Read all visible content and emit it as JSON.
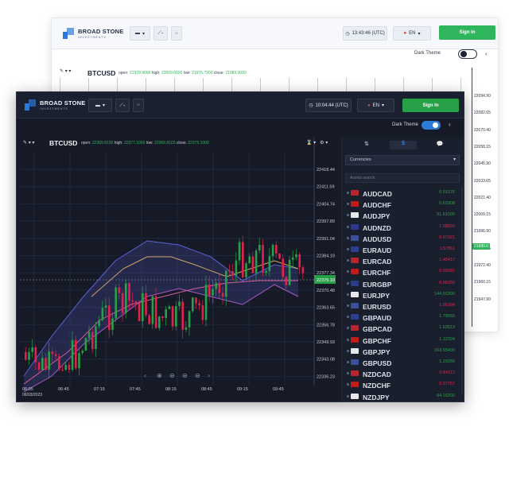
{
  "back_window": {
    "logo_title": "BROAD STONE",
    "logo_subtitle": "INVESTMENTS",
    "time_label": "13:43:46 (UTC)",
    "lang_label": "EN",
    "signin_label": "Sign In",
    "dark_theme_label": "Dark Theme",
    "symbol": "BTCUSD",
    "ohlc": {
      "open_label": "open:",
      "open": "21979.9000",
      "high_label": "high:",
      "high": "22009.8100",
      "low_label": "low:",
      "low": "21976.7900",
      "close_label": "close:",
      "close": "21989.0000"
    },
    "prices": [
      "22094.90",
      "22082.65",
      "22070.40",
      "22058.15",
      "22045.90",
      "22033.65",
      "22021.40",
      "22009.15",
      "21996.90",
      "21984.65",
      "21972.40",
      "21960.15",
      "21947.90"
    ],
    "price_tag": "21989.0"
  },
  "front_window": {
    "logo_title": "BROAD STONE",
    "logo_subtitle": "INVESTMENTS",
    "time_label": "10:04:44 (UTC)",
    "lang_label": "EN",
    "signin_label": "Sign In",
    "dark_theme_label": "Dark Theme",
    "symbol": "BTCUSD",
    "ohlc": {
      "open_label": "open:",
      "open": "22369.8100",
      "high_label": "high:",
      "high": "22377.1000",
      "low_label": "low:",
      "low": "22369.8100",
      "close_label": "close:",
      "close": "22375.1000"
    },
    "panel": {
      "select_label": "Currencies",
      "search_placeholder": "Assets search",
      "instruments": [
        {
          "symbol": "AUDCAD",
          "value": "0.91576",
          "up": true,
          "flag": "#b7252e"
        },
        {
          "symbol": "AUDCHF",
          "value": "0.62908",
          "up": true,
          "flag": "#c21b1b"
        },
        {
          "symbol": "AUDJPY",
          "value": "91.61000",
          "up": true,
          "flag": "#e8e8e8"
        },
        {
          "symbol": "AUDNZD",
          "value": "1.08820",
          "up": false,
          "flag": "#2c3a8c"
        },
        {
          "symbol": "AUDUSD",
          "value": "0.67321",
          "up": false,
          "flag": "#3c4f9a"
        },
        {
          "symbol": "EURAUD",
          "value": "1.57811",
          "up": false,
          "flag": "#2b3f91"
        },
        {
          "symbol": "EURCAD",
          "value": "1.45417",
          "up": false,
          "flag": "#b7252e"
        },
        {
          "symbol": "EURCHF",
          "value": "0.99281",
          "up": false,
          "flag": "#c21b1b"
        },
        {
          "symbol": "EURGBP",
          "value": "0.88356",
          "up": false,
          "flag": "#2a3c86"
        },
        {
          "symbol": "EURJPY",
          "value": "144.55300",
          "up": true,
          "flag": "#e8e8e8"
        },
        {
          "symbol": "EURUSD",
          "value": "1.06284",
          "up": false,
          "flag": "#3c4f9a"
        },
        {
          "symbol": "GBPAUD",
          "value": "1.78559",
          "up": true,
          "flag": "#2b3f91"
        },
        {
          "symbol": "GBPCAD",
          "value": "1.63513",
          "up": true,
          "flag": "#b7252e"
        },
        {
          "symbol": "GBPCHF",
          "value": "1.12324",
          "up": true,
          "flag": "#c21b1b"
        },
        {
          "symbol": "GBPJPY",
          "value": "163.55400",
          "up": true,
          "flag": "#e8e8e8"
        },
        {
          "symbol": "GBPUSD",
          "value": "1.20259",
          "up": true,
          "flag": "#3c4f9a"
        },
        {
          "symbol": "NZDCAD",
          "value": "0.84112",
          "up": false,
          "flag": "#b7252e"
        },
        {
          "symbol": "NZDCHF",
          "value": "0.57757",
          "up": false,
          "flag": "#c21b1b"
        },
        {
          "symbol": "NZDJPY",
          "value": "84.15300",
          "up": true,
          "flag": "#e8e8e8"
        }
      ]
    },
    "chart": {
      "price_labels": [
        "22418.44",
        "22411.59",
        "22404.74",
        "22397.89",
        "22391.04",
        "22384.19",
        "22377.34",
        "22370.48",
        "22363.65",
        "22356.78",
        "22349.93",
        "22343.08",
        "22336.23"
      ],
      "price_tag": "22375.10",
      "time_labels": [
        "06:05",
        "06:45",
        "07:15",
        "07:45",
        "08:15",
        "08:45",
        "09:15",
        "09:45"
      ],
      "date_label": "06/03/2023"
    },
    "colors": {
      "up": "#26a148",
      "down": "#e0224f",
      "accent": "#2d7bd8",
      "signin": "#26a148"
    }
  }
}
